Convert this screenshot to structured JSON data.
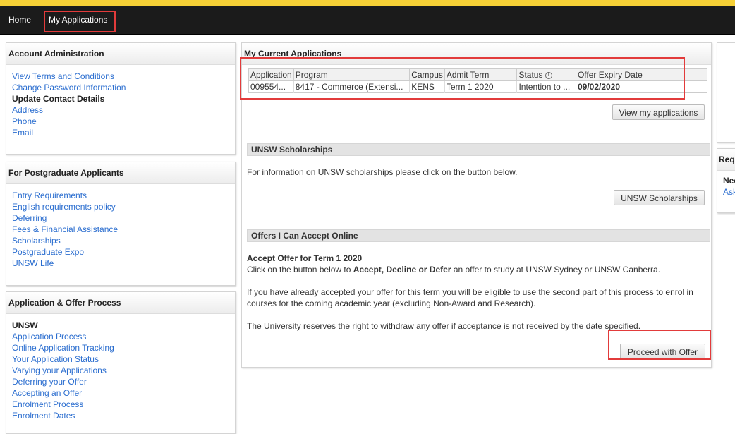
{
  "nav": {
    "home": "Home",
    "my_applications": "My Applications"
  },
  "account": {
    "title": "Account Administration",
    "view_terms": "View Terms and Conditions",
    "change_password": "Change Password Information",
    "update_contact": "Update Contact Details",
    "address": "Address",
    "phone": "Phone",
    "email": "Email"
  },
  "postgrad": {
    "title": "For Postgraduate Applicants",
    "items": [
      "Entry Requirements",
      "English requirements policy",
      "Deferring",
      "Fees & Financial Assistance",
      "Scholarships",
      "Postgraduate Expo",
      "UNSW Life"
    ]
  },
  "process": {
    "title": "Application & Offer Process",
    "group": "UNSW",
    "items": [
      "Application Process",
      "Online Application Tracking",
      "Your Application Status",
      "Varying your Applications",
      "Deferring your Offer",
      "Accepting an Offer",
      "Enrolment Process",
      "Enrolment Dates"
    ]
  },
  "current": {
    "title": "My Current Applications",
    "headers": [
      "Application",
      "Program",
      "Campus",
      "Admit Term",
      "Status",
      "Offer Expiry Date"
    ],
    "status_info_icon": "info-icon",
    "row": [
      "009554...",
      "8417 - Commerce (Extensi...",
      "KENS",
      "Term 1 2020",
      "Intention to ...",
      "09/02/2020"
    ],
    "view_button": "View my applications"
  },
  "scholarships": {
    "title": "UNSW Scholarships",
    "text": "For information on UNSW scholarships please click on the button below.",
    "button": "UNSW Scholarships"
  },
  "offers": {
    "title": "Offers I Can Accept Online",
    "subtitle": "Accept Offer for Term 1 2020",
    "line1_pre": "Click on the button below to ",
    "line1_bold": "Accept, Decline or Defer",
    "line1_post": " an offer to study at UNSW Sydney or UNSW Canberra.",
    "para2": "If you have already accepted your offer for this term you will be eligible to use the second part of this process to enrol in courses for the coming academic year (excluding Non-Award and Research).",
    "para3": "The University reserves the right to withdraw any offer if acceptance is not received by the date specified.",
    "button": "Proceed with Offer"
  },
  "right": {
    "req_title": "Req",
    "nee": "Nee",
    "ask": "Ask"
  },
  "colors": {
    "accent_yellow": "#f6d036",
    "nav_bg": "#1b1b1b",
    "link": "#2a6dcf",
    "highlight_red": "#e23b3b"
  }
}
